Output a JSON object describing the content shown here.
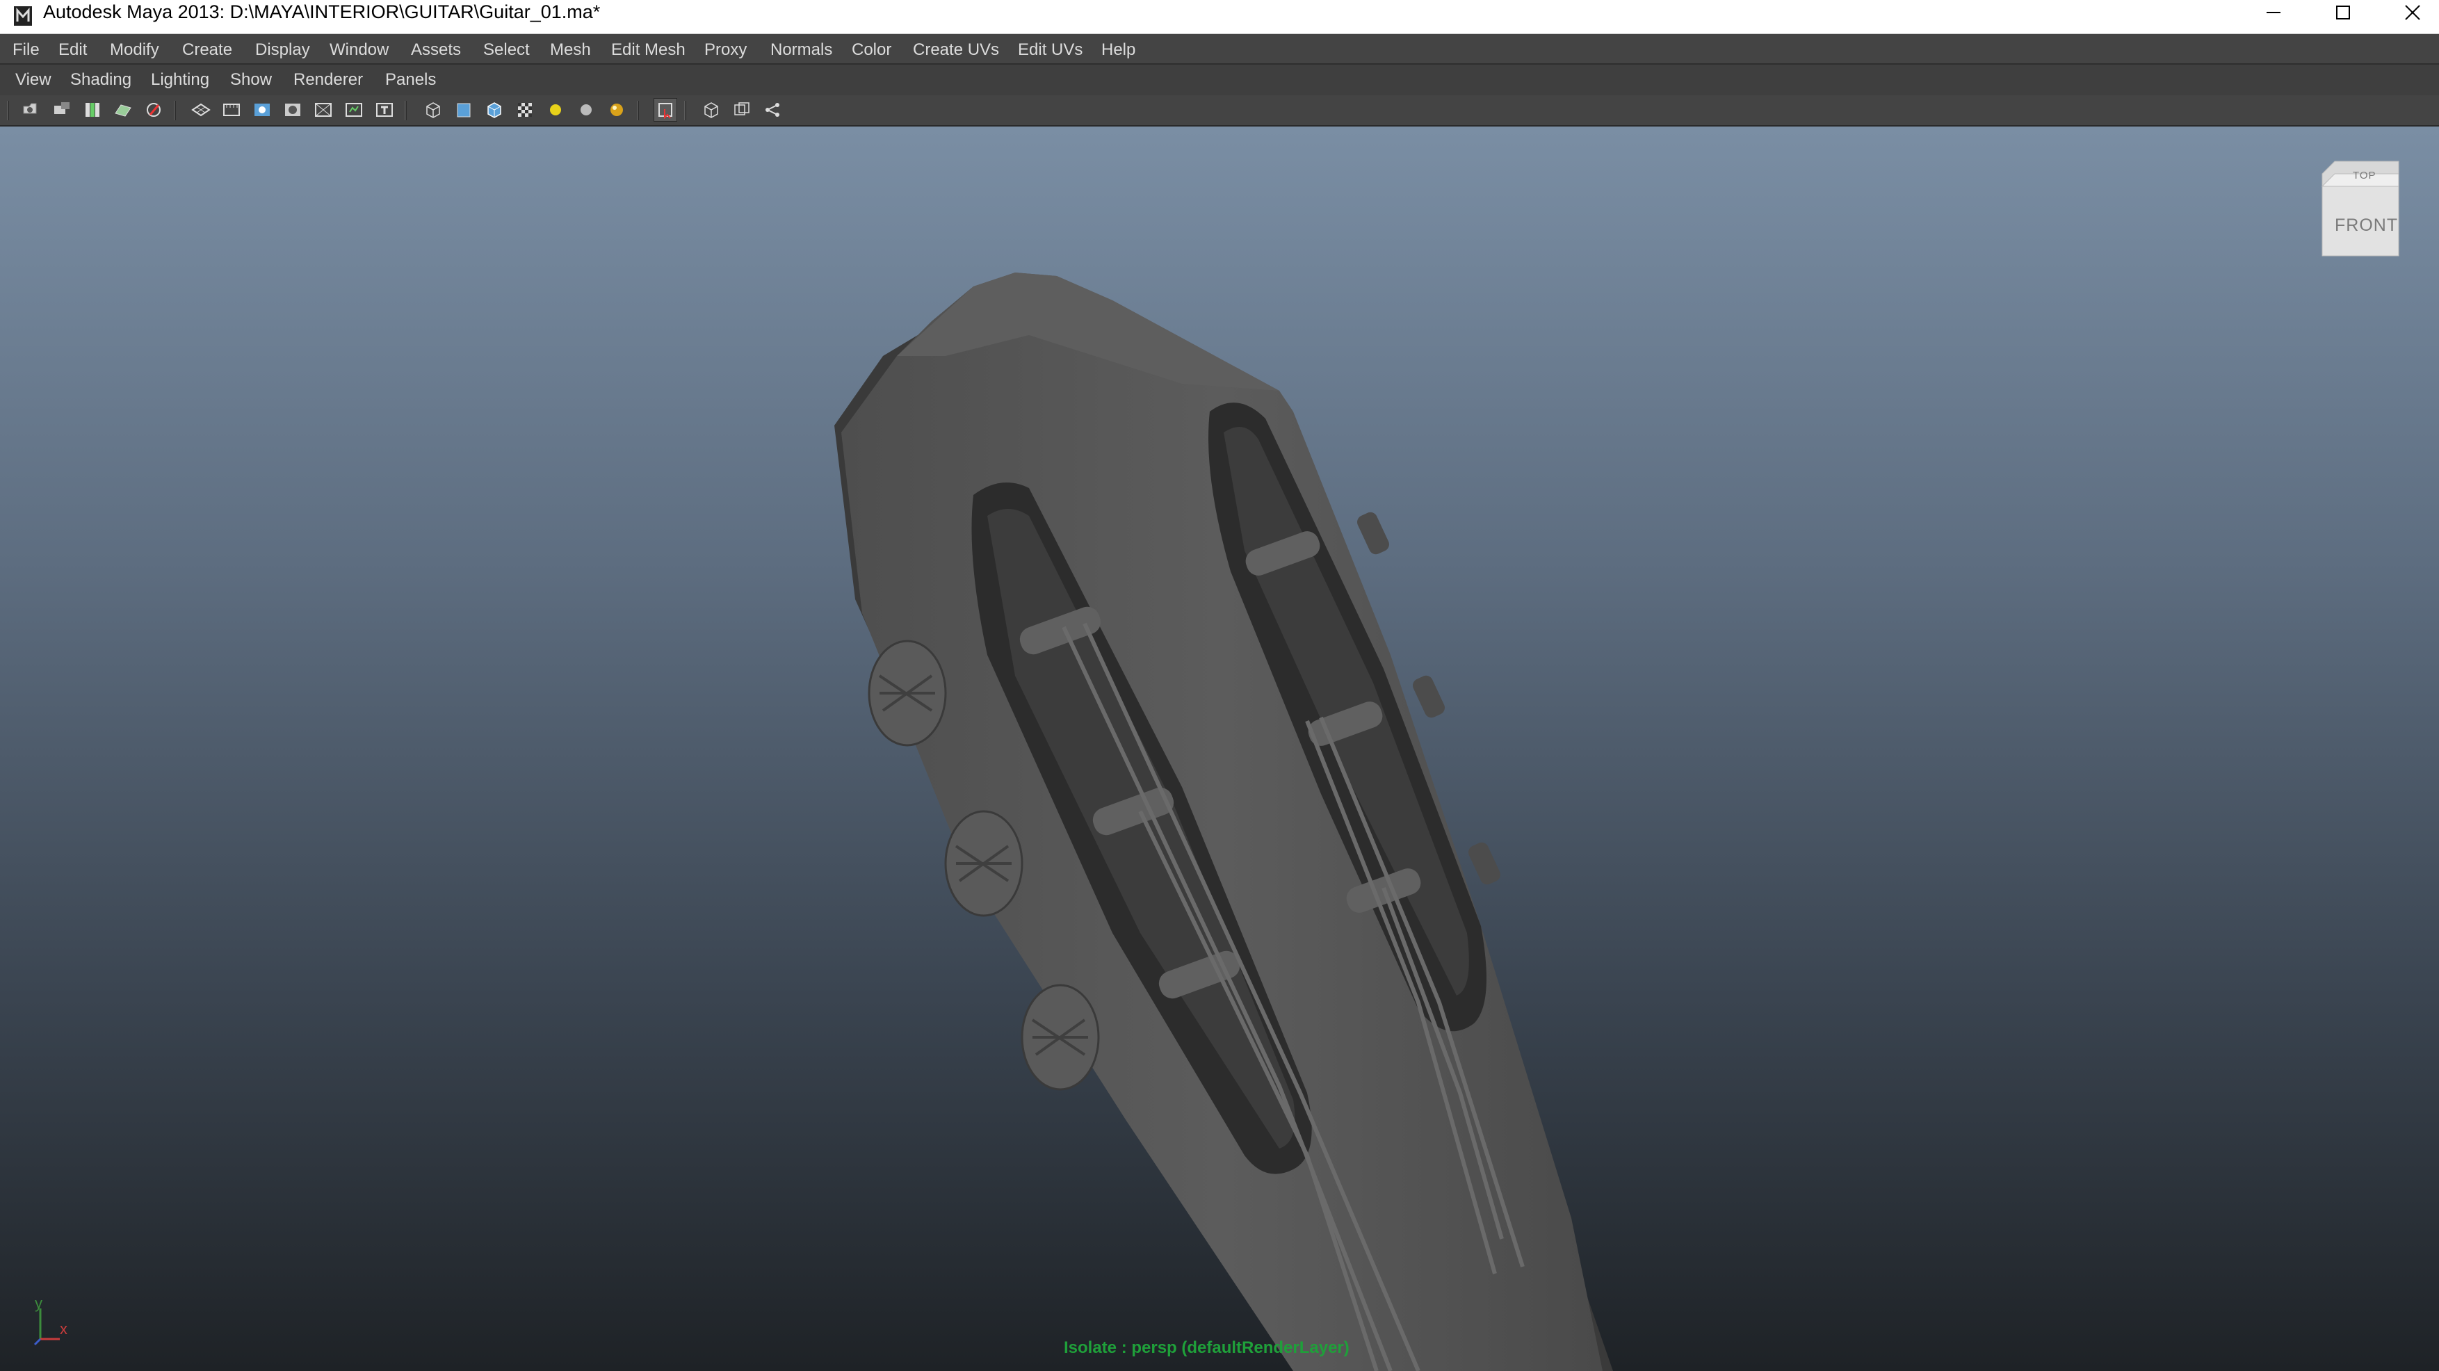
{
  "window": {
    "title": "Autodesk Maya 2013: D:\\MAYA\\INTERIOR\\GUITAR\\Guitar_01.ma*",
    "minimize": "—",
    "maximize": "☐",
    "close": "✕"
  },
  "menu": [
    "File",
    "Edit",
    "Modify",
    "Create",
    "Display",
    "Window",
    "Assets",
    "Select",
    "Mesh",
    "Edit Mesh",
    "Proxy",
    "Normals",
    "Color",
    "Create UVs",
    "Edit UVs",
    "Help"
  ],
  "panel_menu": [
    "View",
    "Shading",
    "Lighting",
    "Show",
    "Renderer",
    "Panels"
  ],
  "toolbar": {
    "icons": [
      "select-camera-icon",
      "camera-attributes-icon",
      "bookmark-icon",
      "image-plane-icon",
      "grease-pencil-icon",
      "grid-icon",
      "film-gate-icon",
      "resolution-gate-icon",
      "gate-mask-icon",
      "field-chart-icon",
      "safe-action-icon",
      "safe-title-icon",
      "wireframe-icon",
      "smooth-shade-icon",
      "wireframe-on-shaded-icon",
      "textured-icon",
      "use-default-lighting-icon",
      "shadows-icon",
      "high-quality-icon",
      "isolate-select-icon",
      "xray-icon",
      "xray-joints-icon",
      "xray-components-icon"
    ]
  },
  "viewport": {
    "viewcube": {
      "top": "TOP",
      "front": "FRONT"
    },
    "hud": "Isolate : persp (defaultRenderLayer)",
    "axis": {
      "y": "y",
      "x": "x"
    },
    "background_top": "#7a8ea4",
    "background_bottom": "#1e2226"
  },
  "colors": {
    "hud_text": "#1fa03a",
    "menu_bg": "#444444",
    "menu_text": "#dcdcdc"
  }
}
